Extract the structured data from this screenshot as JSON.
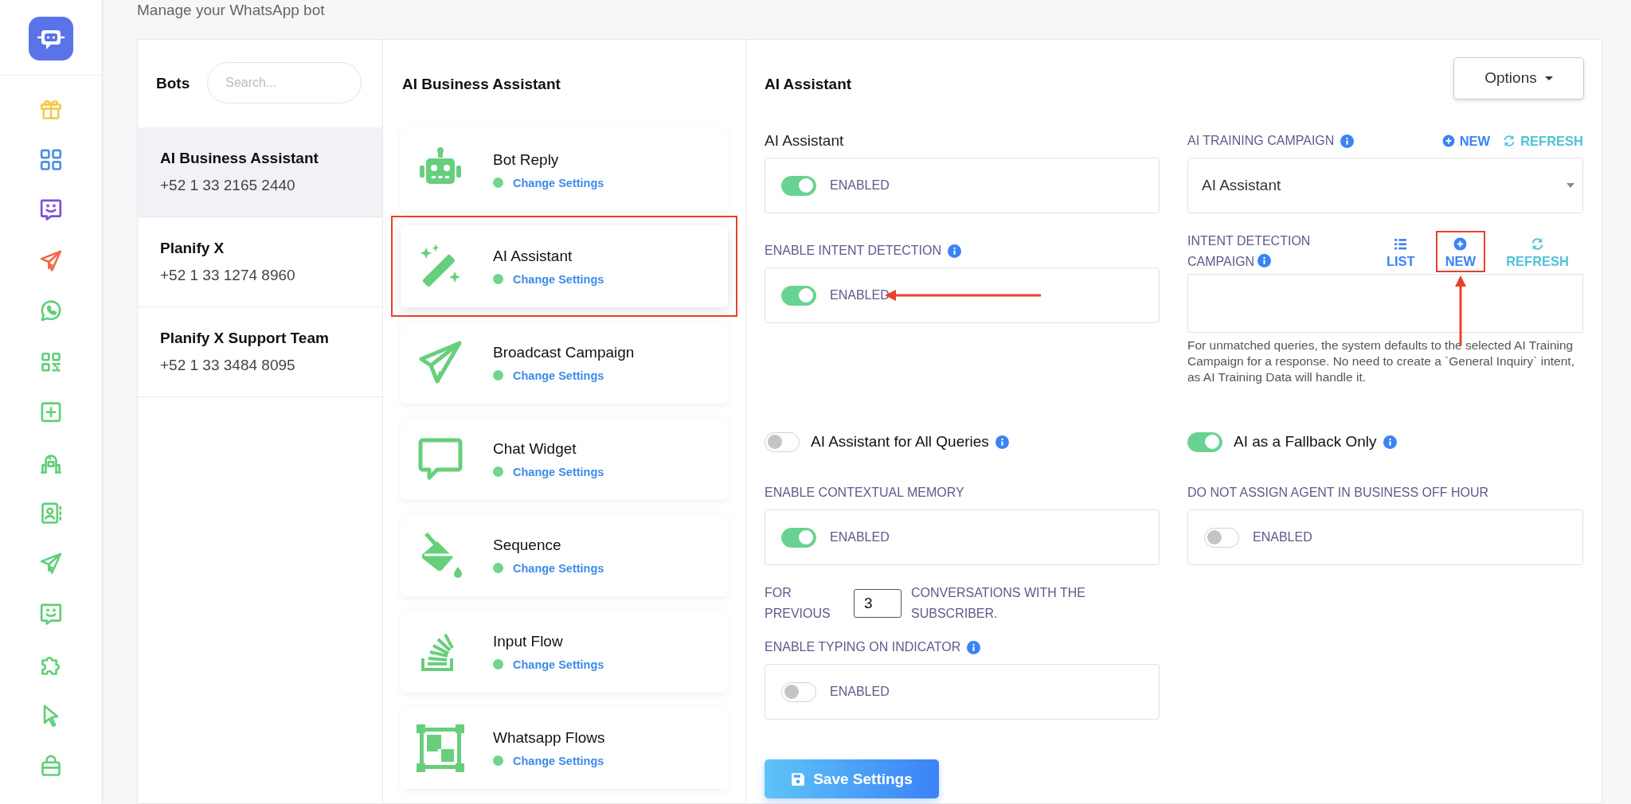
{
  "page_subtitle": "Manage your WhatsApp bot",
  "sidebar": {
    "items": [
      {
        "kind": "gift",
        "color": "#f2c94c"
      },
      {
        "kind": "grid",
        "color": "#4a90e2"
      },
      {
        "kind": "chat",
        "color": "#7b4ee0"
      },
      {
        "kind": "plane",
        "color": "#ee6a4a"
      },
      {
        "kind": "phone-bubble",
        "color": "#5fcf77"
      },
      {
        "kind": "qr",
        "color": "#5fcf77"
      },
      {
        "kind": "plus",
        "color": "#5fcf77"
      },
      {
        "kind": "robot",
        "color": "#5fcf77"
      },
      {
        "kind": "contact",
        "color": "#5fcf77"
      },
      {
        "kind": "plane",
        "color": "#5fcf77"
      },
      {
        "kind": "chat",
        "color": "#5fcf77"
      },
      {
        "kind": "puzzle",
        "color": "#5fcf77"
      },
      {
        "kind": "cursor",
        "color": "#5fcf77"
      },
      {
        "kind": "bag",
        "color": "#5fcf77"
      }
    ]
  },
  "bots": {
    "title": "Bots",
    "search": {
      "placeholder": "Search..."
    },
    "items": [
      {
        "name": "AI Business Assistant",
        "phone": "+52 1 33 2165 2440",
        "selected": true
      },
      {
        "name": "Planify X",
        "phone": "+52 1 33 1274 8960",
        "selected": false
      },
      {
        "name": "Planify X Support Team",
        "phone": "+52 1 33 3484 8095",
        "selected": false
      }
    ]
  },
  "features": {
    "title": "AI Business Assistant",
    "items": [
      {
        "kind": "robot",
        "title": "Bot Reply",
        "link": "Change Settings",
        "selected": false
      },
      {
        "kind": "wand",
        "title": "AI Assistant",
        "link": "Change Settings",
        "selected": true
      },
      {
        "kind": "plane",
        "title": "Broadcast Campaign",
        "link": "Change Settings",
        "selected": false
      },
      {
        "kind": "bubble",
        "title": "Chat Widget",
        "link": "Change Settings",
        "selected": false
      },
      {
        "kind": "bucket",
        "title": "Sequence",
        "link": "Change Settings",
        "selected": false
      },
      {
        "kind": "stack",
        "title": "Input Flow",
        "link": "Change Settings",
        "selected": false
      },
      {
        "kind": "frame",
        "title": "Whatsapp Flows",
        "link": "Change Settings",
        "selected": false
      }
    ]
  },
  "settings": {
    "title": "AI Assistant",
    "options_button": "Options",
    "ai_assistant": {
      "label": "AI Assistant",
      "on": true,
      "state_text": "ENABLED"
    },
    "training_campaign": {
      "label": "AI TRAINING CAMPAIGN",
      "new_link": "NEW",
      "refresh_link": "REFRESH",
      "value": "AI Assistant"
    },
    "intent_detection": {
      "label": "ENABLE INTENT DETECTION",
      "on": true,
      "state_text": "ENABLED",
      "arrow": true
    },
    "intent_campaign": {
      "label": "INTENT DETECTION CAMPAIGN",
      "actions": [
        {
          "kind": "list",
          "label": "LIST",
          "highlighted": false
        },
        {
          "kind": "new",
          "label": "NEW",
          "highlighted": true
        },
        {
          "kind": "refresh",
          "label": "REFRESH",
          "highlighted": false
        }
      ],
      "help": "For unmatched queries, the system defaults to the selected AI Training Campaign for a response. No need to create a `General Inquiry` intent, as AI Training Data will handle it."
    },
    "modes": [
      {
        "label": "AI Assistant for All Queries",
        "on": false
      },
      {
        "label": "AI as a Fallback Only",
        "on": true
      }
    ],
    "contextual_memory": {
      "label": "ENABLE CONTEXTUAL MEMORY",
      "on": true,
      "state_text": "ENABLED"
    },
    "off_hour": {
      "label": "DO NOT ASSIGN AGENT IN BUSINESS OFF HOUR",
      "on": false,
      "state_text": "ENABLED"
    },
    "history": {
      "prefix": "FOR PREVIOUS",
      "value": "3",
      "suffix": "CONVERSATIONS WITH THE SUBSCRIBER."
    },
    "typing_indicator": {
      "label": "ENABLE TYPING ON INDICATOR",
      "on": false,
      "state_text": "ENABLED"
    },
    "save_button": "Save Settings"
  }
}
